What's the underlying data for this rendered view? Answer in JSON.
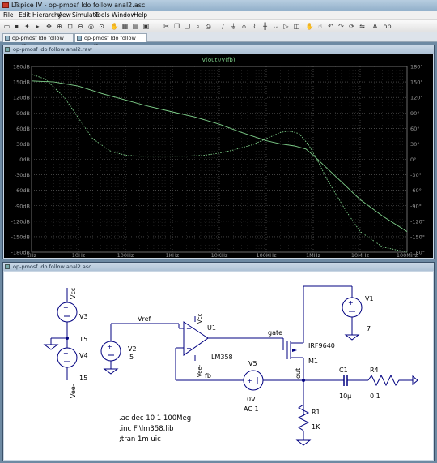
{
  "app": {
    "title": "LTspice IV - op-pmosf ldo follow anal2.asc"
  },
  "menu": [
    "File",
    "Edit",
    "Hierarchy",
    "View",
    "Simulate",
    "Tools",
    "Window",
    "Help"
  ],
  "tabs": [
    {
      "label": "op-pmosf ldo follow anal2.raw"
    },
    {
      "label": "op-pmosf ldo follow anal2.asc"
    }
  ],
  "plot_window": {
    "title": "op-pmosf ldo follow anal2.raw"
  },
  "schematic_window": {
    "title": "op-pmosf ldo follow anal2.asc"
  },
  "chart_data": {
    "type": "line",
    "title": "V(out)/V(fb)",
    "x_scale": "log",
    "x_ticks": [
      "1Hz",
      "10Hz",
      "100Hz",
      "1KHz",
      "10KHz",
      "100KHz",
      "1MHz",
      "10MHz",
      "100MHz"
    ],
    "xlim": [
      1,
      100000000
    ],
    "y_left_ticks": [
      "180dB",
      "150dB",
      "120dB",
      "90dB",
      "60dB",
      "30dB",
      "0dB",
      "-30dB",
      "-60dB",
      "-90dB",
      "-120dB",
      "-150dB",
      "-180dB"
    ],
    "ylim_left": [
      -180,
      180
    ],
    "y_right_ticks": [
      "180°",
      "150°",
      "120°",
      "90°",
      "60°",
      "30°",
      "0°",
      "-30°",
      "-60°",
      "-90°",
      "-120°",
      "-150°",
      "-180°"
    ],
    "ylim_right": [
      -180,
      180
    ],
    "grid": true,
    "trace_color": "#7fd08a",
    "series": [
      {
        "kind": "magnitude",
        "x": [
          1,
          3,
          10,
          30,
          100,
          300,
          1000,
          3000,
          10000,
          30000,
          100000,
          200000,
          400000,
          700000,
          1000000,
          2000000,
          5000000,
          10000000,
          30000000,
          100000000
        ],
        "y": [
          152,
          150,
          142,
          128,
          115,
          103,
          92,
          82,
          68,
          52,
          36,
          30,
          26,
          20,
          8,
          -18,
          -52,
          -78,
          -110,
          -140
        ]
      },
      {
        "kind": "phase",
        "x": [
          1,
          2,
          5,
          10,
          20,
          50,
          100,
          200,
          500,
          1000,
          2000,
          5000,
          10000,
          20000,
          50000,
          100000,
          200000,
          300000,
          500000,
          800000,
          1200000,
          2000000,
          5000000,
          10000000,
          30000000,
          100000000
        ],
        "y": [
          165,
          155,
          120,
          80,
          40,
          15,
          8,
          6,
          6,
          6,
          6,
          8,
          12,
          18,
          28,
          40,
          52,
          55,
          50,
          28,
          0,
          -40,
          -100,
          -140,
          -170,
          -180
        ]
      }
    ]
  },
  "schematic": {
    "components": {
      "V3": {
        "name": "V3",
        "net": "Vcc",
        "value": "15"
      },
      "V4": {
        "name": "V4",
        "net": "Vee-",
        "value": "15"
      },
      "V2": {
        "name": "V2",
        "value": "5"
      },
      "U1": {
        "name": "U1",
        "model": "LM358",
        "vcc": "Vcc",
        "vee": "Vee-"
      },
      "V1": {
        "name": "V1",
        "value": "7"
      },
      "M1": {
        "name": "M1",
        "model": "IRF9640"
      },
      "V5": {
        "name": "V5",
        "dc": "0V",
        "ac": "AC 1"
      },
      "C1": {
        "name": "C1",
        "value": "10µ"
      },
      "R4": {
        "name": "R4",
        "value": "0.1"
      },
      "R1": {
        "name": "R1",
        "value": "1K"
      }
    },
    "nets": {
      "vref": "Vref",
      "gate": "gate",
      "fb": "fb",
      "out": "out"
    },
    "directives": [
      ".ac dec 10 1 100Meg",
      ".inc F:\\lm358.lib",
      ";tran 1m uic"
    ]
  }
}
